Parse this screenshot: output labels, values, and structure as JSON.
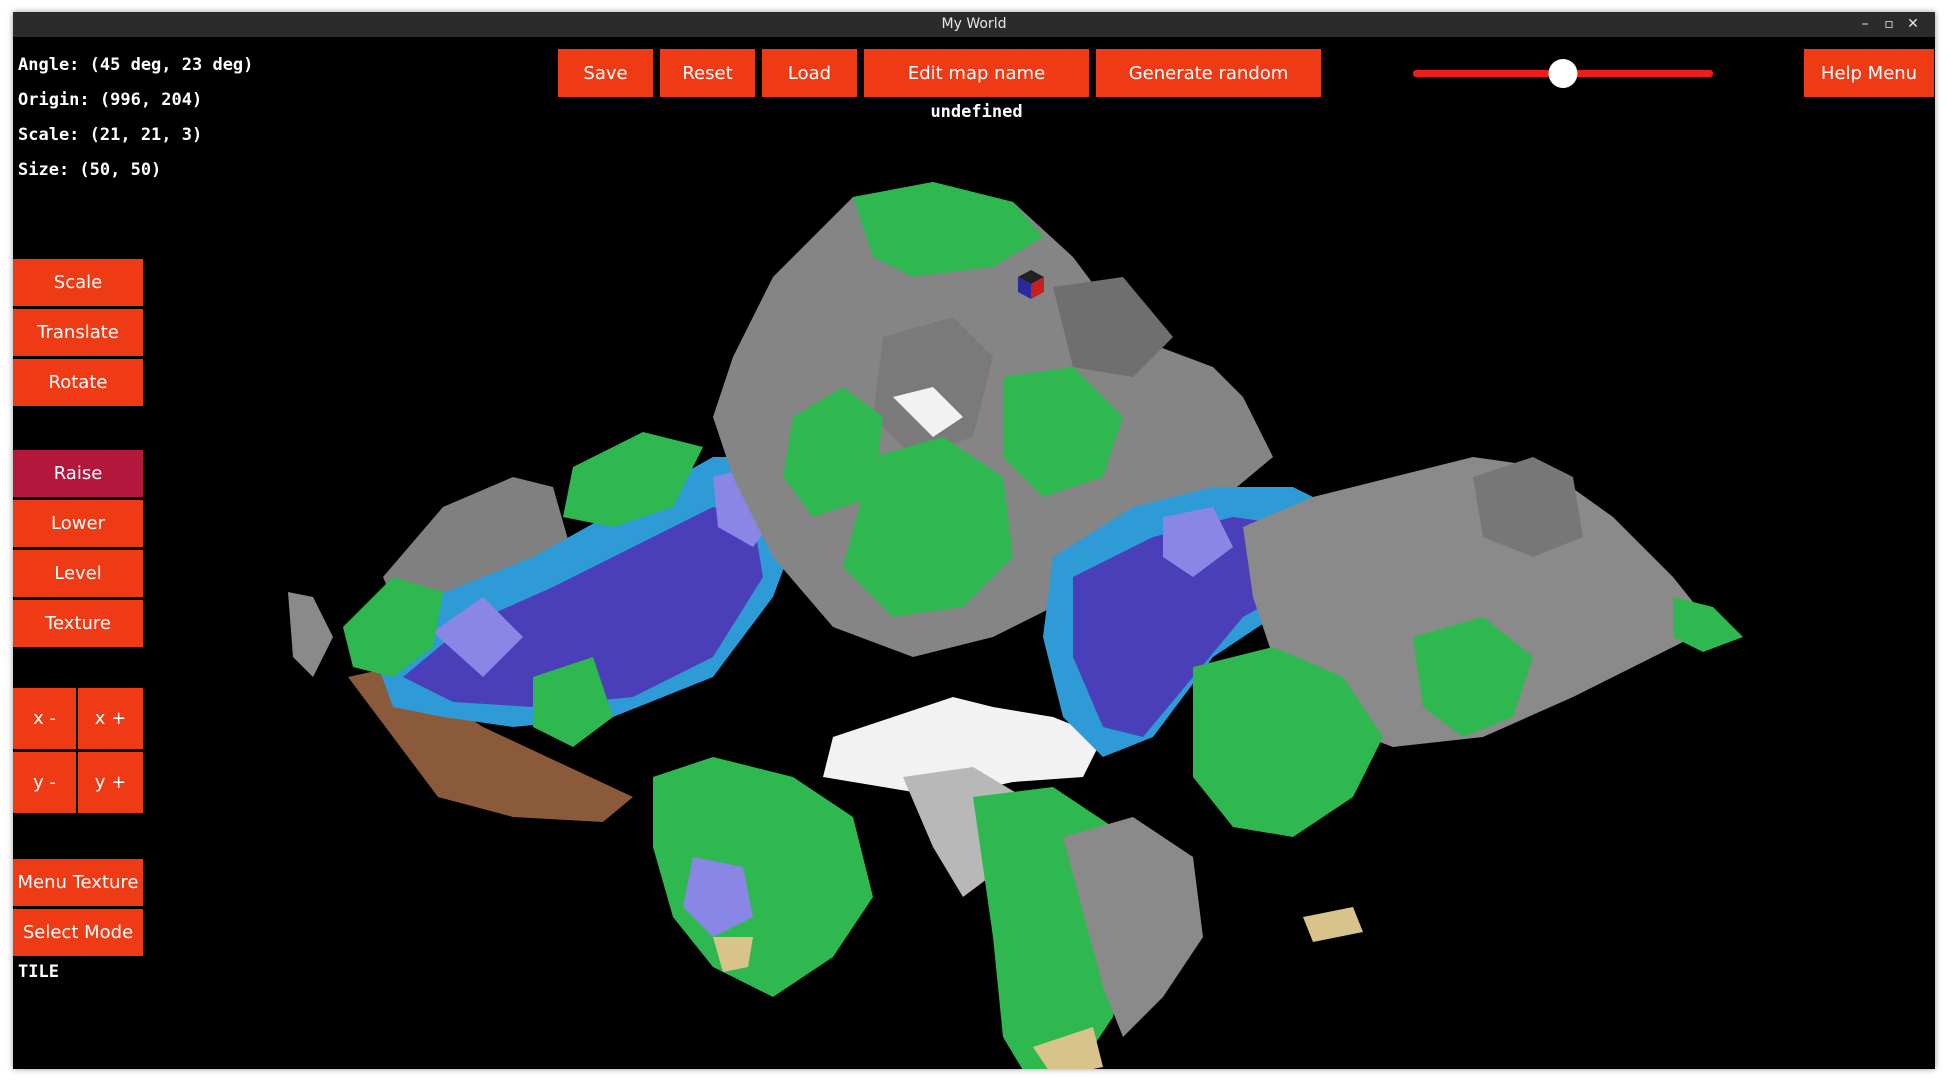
{
  "window": {
    "title": "My World"
  },
  "info": {
    "angle": "Angle: (45 deg, 23 deg)",
    "origin": "Origin: (996, 204)",
    "scale": "Scale: (21, 21, 3)",
    "size": "Size: (50, 50)"
  },
  "toolbar": {
    "save": "Save",
    "reset": "Reset",
    "load": "Load",
    "edit_map_name": "Edit map name",
    "generate_random": "Generate random",
    "help_menu": "Help Menu"
  },
  "map_name": "undefined",
  "slider": {
    "value": 0.5
  },
  "side_menu": {
    "transform": [
      "Scale",
      "Translate",
      "Rotate"
    ],
    "tools": [
      "Raise",
      "Lower",
      "Level",
      "Texture"
    ],
    "active_tool": "Raise",
    "nav": {
      "x_minus": "x -",
      "x_plus": "x +",
      "y_minus": "y -",
      "y_plus": "y +"
    },
    "menu_texture": "Menu Texture",
    "select_mode": "Select Mode"
  },
  "mode": "TILE",
  "colors": {
    "button": "#ee3b16",
    "active_button": "#b3183c",
    "grass": "#2fb84f",
    "rock": "#7a7a7a",
    "water": "#5a4fc8",
    "snow": "#f2f2f2",
    "dirt": "#8a5a3a"
  }
}
